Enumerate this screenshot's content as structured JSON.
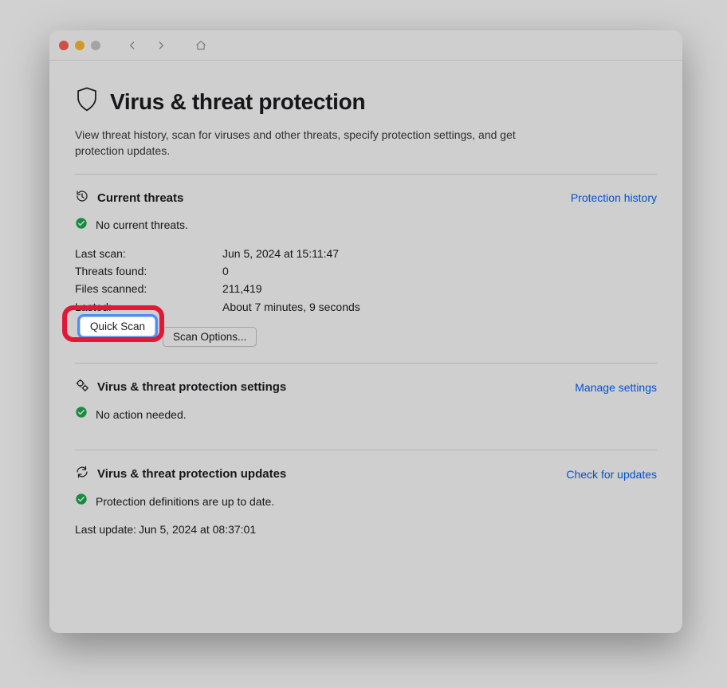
{
  "page": {
    "title": "Virus & threat protection",
    "description": "View threat history, scan for viruses and other threats, specify protection settings, and get protection updates."
  },
  "sections": {
    "current_threats": {
      "title": "Current threats",
      "link_label": "Protection history",
      "status": "No current threats.",
      "rows": {
        "last_scan_label": "Last scan:",
        "last_scan_value": "Jun 5, 2024 at 15:11:47",
        "threats_found_label": "Threats found:",
        "threats_found_value": "0",
        "files_scanned_label": "Files scanned:",
        "files_scanned_value": "211,419",
        "lasted_label": "Lasted:",
        "lasted_value": "About 7 minutes, 9 seconds"
      },
      "buttons": {
        "quick_scan": "Quick Scan",
        "scan_options": "Scan Options..."
      }
    },
    "settings": {
      "title": "Virus & threat protection settings",
      "link_label": "Manage settings",
      "status": "No action needed."
    },
    "updates": {
      "title": "Virus & threat protection updates",
      "link_label": "Check for updates",
      "status": "Protection definitions are up to date.",
      "last_update_label": "Last update:",
      "last_update_value": "Jun 5, 2024 at 08:37:01"
    }
  }
}
